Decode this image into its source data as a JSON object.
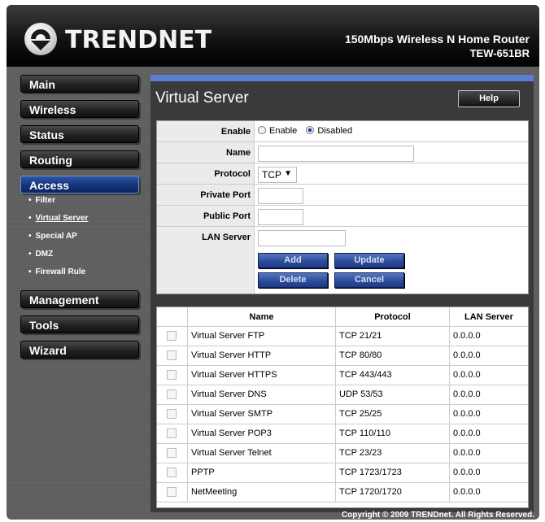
{
  "header": {
    "brand": "TRENDNET",
    "product": "150Mbps Wireless N Home Router",
    "model": "TEW-651BR"
  },
  "sidebar": {
    "items": [
      {
        "label": "Main"
      },
      {
        "label": "Wireless"
      },
      {
        "label": "Status"
      },
      {
        "label": "Routing"
      },
      {
        "label": "Access"
      },
      {
        "label": "Management"
      },
      {
        "label": "Tools"
      },
      {
        "label": "Wizard"
      }
    ],
    "active": "Access",
    "access_sub": [
      {
        "label": "Filter"
      },
      {
        "label": "Virtual Server"
      },
      {
        "label": "Special AP"
      },
      {
        "label": "DMZ"
      },
      {
        "label": "Firewall Rule"
      }
    ],
    "bullet": "•"
  },
  "page": {
    "title": "Virtual Server",
    "help_label": "Help"
  },
  "form": {
    "enable_label": "Enable",
    "enable_option": "Enable",
    "disabled_option": "Disabled",
    "enable_selected": "Disabled",
    "name_label": "Name",
    "name_value": "",
    "protocol_label": "Protocol",
    "protocol_value": "TCP",
    "private_port_label": "Private Port",
    "private_port_value": "",
    "public_port_label": "Public Port",
    "public_port_value": "",
    "lan_server_label": "LAN Server",
    "lan_server_value": "",
    "add_label": "Add",
    "update_label": "Update",
    "delete_label": "Delete",
    "cancel_label": "Cancel"
  },
  "table": {
    "headers": [
      "",
      "Name",
      "Protocol",
      "LAN Server"
    ],
    "rows": [
      {
        "name": "Virtual Server FTP",
        "protocol": "TCP 21/21",
        "lan": "0.0.0.0"
      },
      {
        "name": "Virtual Server HTTP",
        "protocol": "TCP 80/80",
        "lan": "0.0.0.0"
      },
      {
        "name": "Virtual Server HTTPS",
        "protocol": "TCP 443/443",
        "lan": "0.0.0.0"
      },
      {
        "name": "Virtual Server DNS",
        "protocol": "UDP 53/53",
        "lan": "0.0.0.0"
      },
      {
        "name": "Virtual Server SMTP",
        "protocol": "TCP 25/25",
        "lan": "0.0.0.0"
      },
      {
        "name": "Virtual Server POP3",
        "protocol": "TCP 110/110",
        "lan": "0.0.0.0"
      },
      {
        "name": "Virtual Server Telnet",
        "protocol": "TCP 23/23",
        "lan": "0.0.0.0"
      },
      {
        "name": "PPTP",
        "protocol": "TCP 1723/1723",
        "lan": "0.0.0.0"
      },
      {
        "name": "NetMeeting",
        "protocol": "TCP 1720/1720",
        "lan": "0.0.0.0"
      }
    ]
  },
  "footer": {
    "copyright": "Copyright © 2009 TRENDnet. All Rights Reserved."
  },
  "colors": {
    "accent_blue": "#5a7ed0",
    "button_blue": "#2c4c9a",
    "frame_gray": "#5e5e5e"
  }
}
